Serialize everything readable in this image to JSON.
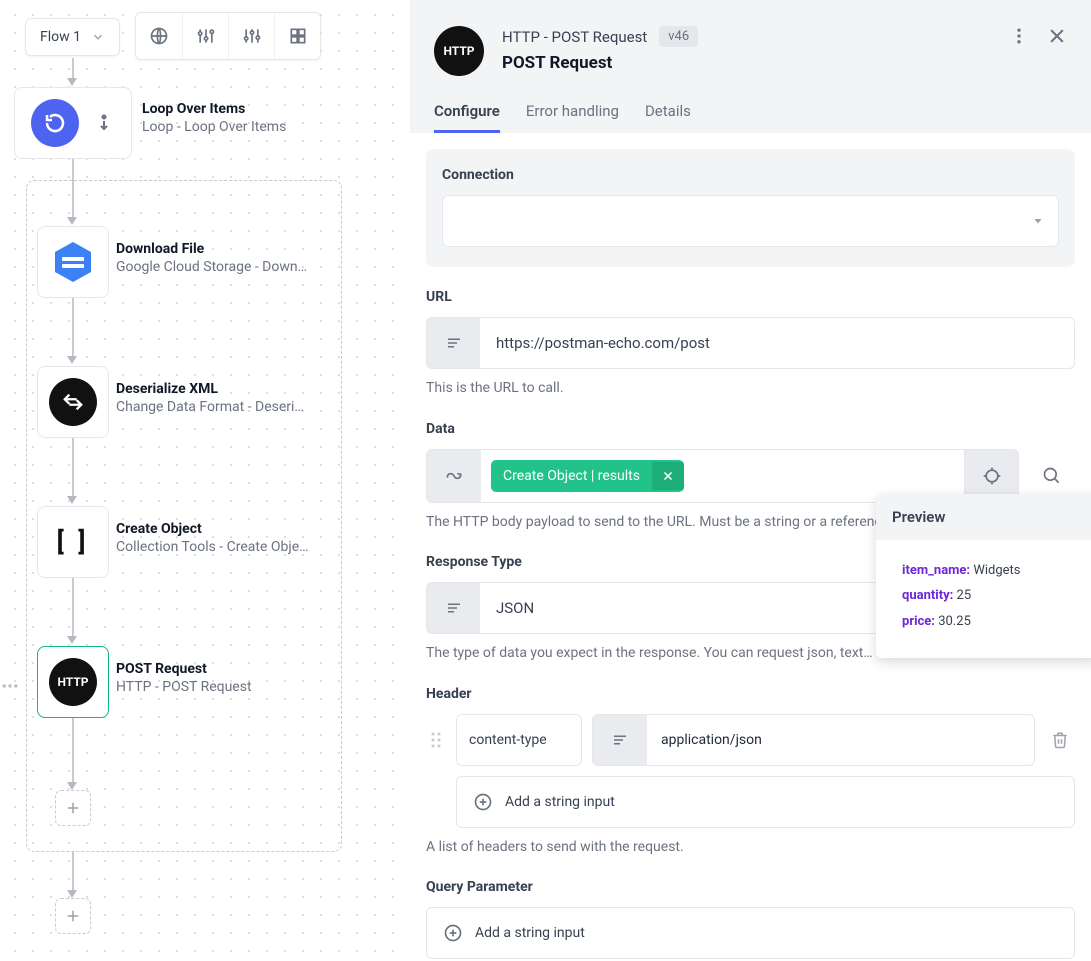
{
  "flow_selector": {
    "name": "Flow 1"
  },
  "nodes": {
    "loop": {
      "title": "Loop Over Items",
      "sub": "Loop - Loop Over Items"
    },
    "download": {
      "title": "Download File",
      "sub": "Google Cloud Storage - Down…"
    },
    "deserialize": {
      "title": "Deserialize XML",
      "sub": "Change Data Format - Deseri…"
    },
    "create_obj": {
      "title": "Create Object",
      "sub": "Collection Tools - Create Obje…"
    },
    "post": {
      "title": "POST Request",
      "sub": "HTTP - POST Request"
    }
  },
  "panel": {
    "icon_text": "HTTP",
    "app_name": "HTTP - POST Request",
    "version": "v46",
    "title": "POST Request",
    "tabs": {
      "configure": "Configure",
      "error": "Error handling",
      "details": "Details"
    },
    "connection_label": "Connection",
    "url": {
      "label": "URL",
      "value": "https://postman-echo.com/post",
      "helper": "This is the URL to call."
    },
    "data": {
      "label": "Data",
      "chip": "Create Object | results",
      "helper": "The HTTP body payload to send to the URL. Must be a string or a reference to a previous step."
    },
    "response_type": {
      "label": "Response Type",
      "value": "JSON",
      "helper": "The type of data you expect in the response. You can request json, text…"
    },
    "header": {
      "label": "Header",
      "key": "content-type",
      "value": "application/json",
      "add": "Add a string input",
      "helper": "A list of headers to send with the request."
    },
    "query": {
      "label": "Query Parameter",
      "add": "Add a string input"
    }
  },
  "preview": {
    "title": "Preview",
    "rows": [
      {
        "k": "item_name:",
        "v": "Widgets"
      },
      {
        "k": "quantity:",
        "v": "25"
      },
      {
        "k": "price:",
        "v": "30.25"
      }
    ]
  }
}
